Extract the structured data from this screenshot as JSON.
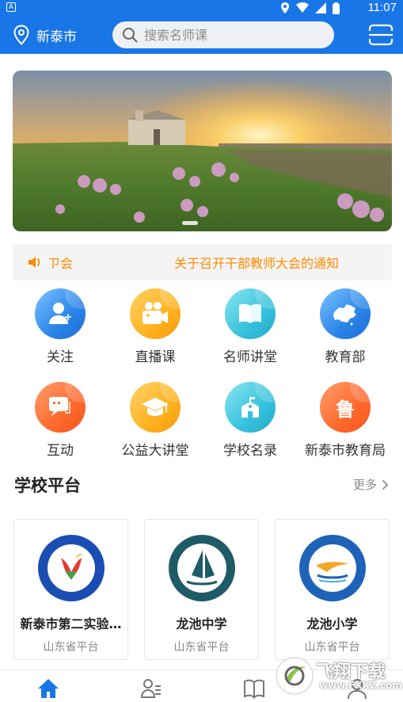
{
  "status_bar": {
    "time": "11:07"
  },
  "header": {
    "city": "新泰市",
    "search_placeholder": "搜索名师课"
  },
  "notice": {
    "tag": "⁠ㄗ会",
    "message": "关于召开干部教师大会的通知"
  },
  "grid": [
    {
      "label": "关注",
      "icon": "user-add-icon",
      "color": "blue"
    },
    {
      "label": "直播课",
      "icon": "video-camera-icon",
      "color": "orange"
    },
    {
      "label": "名师讲堂",
      "icon": "book-icon",
      "color": "cyan"
    },
    {
      "label": "教育部",
      "icon": "china-map-icon",
      "color": "blue"
    },
    {
      "label": "互动",
      "icon": "chat-bubble-icon",
      "color": "red"
    },
    {
      "label": "公益大讲堂",
      "icon": "graduation-cap-icon",
      "color": "orange"
    },
    {
      "label": "学校名录",
      "icon": "school-building-icon",
      "color": "cyan"
    },
    {
      "label": "新泰市教育局",
      "icon": "lu-character-icon",
      "color": "red",
      "glyph": "鲁"
    }
  ],
  "schools_section": {
    "title": "学校平台",
    "more_label": "更多"
  },
  "schools": [
    {
      "name": "新泰市第二实验…",
      "platform": "山东省平台"
    },
    {
      "name": "龙池中学",
      "platform": "山东省平台"
    },
    {
      "name": "龙池小学",
      "platform": "山东省平台"
    }
  ],
  "watermark": {
    "brand": "飞翔下载",
    "url": "www.FXXZ.com"
  },
  "colors": {
    "primary": "#1976e6",
    "notice_orange": "#ff8a00"
  }
}
